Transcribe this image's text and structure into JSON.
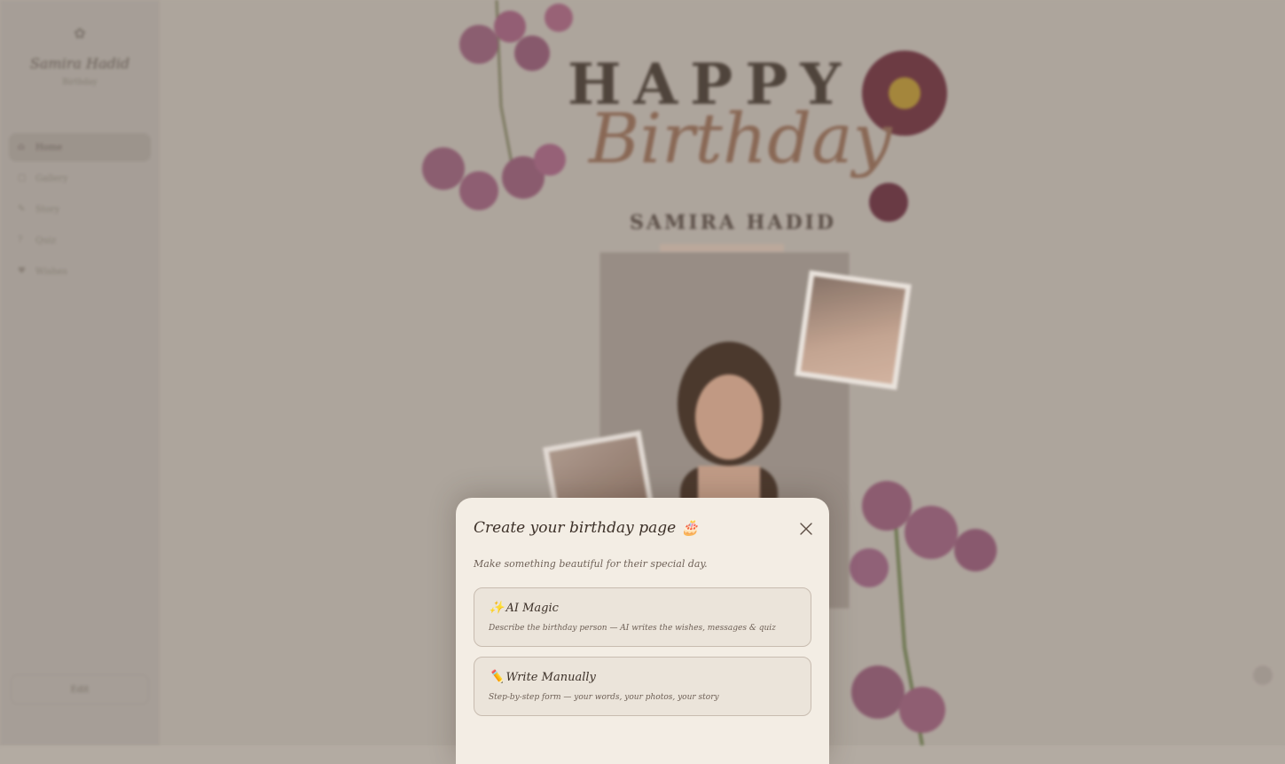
{
  "sidebar": {
    "logo_icon": "sparkle-icon",
    "name": "Samira Hadid",
    "subtitle": "Birthday",
    "date": "",
    "nav": [
      {
        "label": "Home",
        "icon": "home-icon"
      },
      {
        "label": "Gallery",
        "icon": "gallery-icon"
      },
      {
        "label": "Story",
        "icon": "story-icon"
      },
      {
        "label": "Quiz",
        "icon": "quiz-icon"
      },
      {
        "label": "Wishes",
        "icon": "wishes-icon"
      }
    ],
    "bottom_button": "Edit",
    "footer": ""
  },
  "hero": {
    "happy": "HAPPY",
    "birthday": "Birthday",
    "name": "SAMIRA HADID"
  },
  "modal": {
    "title": "Create your birthday page 🎂",
    "subtitle": "Make something beautiful for their special day.",
    "close_icon": "close-icon",
    "options": [
      {
        "icon": "✨",
        "title": "AI Magic",
        "description": "Describe the birthday person — AI writes the wishes, messages & quiz"
      },
      {
        "icon": "✏️",
        "title": "Write Manually",
        "description": "Step-by-step form — your words, your photos, your story"
      }
    ]
  },
  "colors": {
    "backdrop": "#b3aba2",
    "modal_bg": "#f3ede4",
    "option_bg": "#ebe4da",
    "text_dark": "#3c3028",
    "accent_rose": "#8c6a56"
  }
}
